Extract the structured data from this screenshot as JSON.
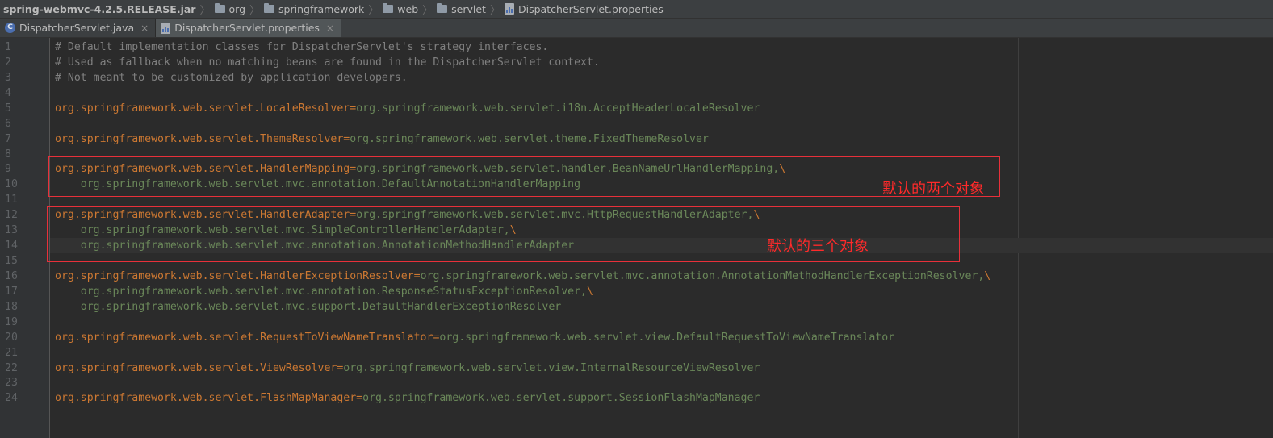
{
  "breadcrumb": {
    "items": [
      {
        "label": "spring-webmvc-4.2.5.RELEASE.jar",
        "icon": "jar"
      },
      {
        "label": "org",
        "icon": "folder-icon"
      },
      {
        "label": "springframework",
        "icon": "folder-icon"
      },
      {
        "label": "web",
        "icon": "folder-icon"
      },
      {
        "label": "servlet",
        "icon": "folder-icon"
      },
      {
        "label": "DispatcherServlet.properties",
        "icon": "properties-file-icon"
      }
    ]
  },
  "tabs": [
    {
      "label": "DispatcherServlet.java",
      "icon": "class-icon",
      "close": "×",
      "active": false
    },
    {
      "label": "DispatcherServlet.properties",
      "icon": "properties-file-icon",
      "close": "×",
      "active": true
    }
  ],
  "editor": {
    "lines": [
      {
        "num": "1",
        "comment": "# Default implementation classes for DispatcherServlet's strategy interfaces."
      },
      {
        "num": "2",
        "comment": "# Used as fallback when no matching beans are found in the DispatcherServlet context."
      },
      {
        "num": "3",
        "comment": "# Not meant to be customized by application developers."
      },
      {
        "num": "4"
      },
      {
        "num": "5",
        "key": "org.springframework.web.servlet.LocaleResolver",
        "eq": "=",
        "value": "org.springframework.web.servlet.i18n.AcceptHeaderLocaleResolver"
      },
      {
        "num": "6"
      },
      {
        "num": "7",
        "key": "org.springframework.web.servlet.ThemeResolver",
        "eq": "=",
        "value": "org.springframework.web.servlet.theme.FixedThemeResolver"
      },
      {
        "num": "8"
      },
      {
        "num": "9",
        "key": "org.springframework.web.servlet.HandlerMapping",
        "eq": "=",
        "value": "org.springframework.web.servlet.handler.BeanNameUrlHandlerMapping,",
        "cont": "\\"
      },
      {
        "num": "10",
        "value": "    org.springframework.web.servlet.mvc.annotation.DefaultAnnotationHandlerMapping"
      },
      {
        "num": "11"
      },
      {
        "num": "12",
        "key": "org.springframework.web.servlet.HandlerAdapter",
        "eq": "=",
        "value": "org.springframework.web.servlet.mvc.HttpRequestHandlerAdapter,",
        "cont": "\\"
      },
      {
        "num": "13",
        "value": "    org.springframework.web.servlet.mvc.SimpleControllerHandlerAdapter,",
        "cont": "\\"
      },
      {
        "num": "14",
        "value": "    org.springframework.web.servlet.mvc.annotation.AnnotationMethodHandlerAdapter",
        "current": true
      },
      {
        "num": "15"
      },
      {
        "num": "16",
        "key": "org.springframework.web.servlet.HandlerExceptionResolver",
        "eq": "=",
        "value": "org.springframework.web.servlet.mvc.annotation.AnnotationMethodHandlerExceptionResolver,",
        "cont": "\\"
      },
      {
        "num": "17",
        "value": "    org.springframework.web.servlet.mvc.annotation.ResponseStatusExceptionResolver,",
        "cont": "\\"
      },
      {
        "num": "18",
        "value": "    org.springframework.web.servlet.mvc.support.DefaultHandlerExceptionResolver"
      },
      {
        "num": "19"
      },
      {
        "num": "20",
        "key": "org.springframework.web.servlet.RequestToViewNameTranslator",
        "eq": "=",
        "value": "org.springframework.web.servlet.view.DefaultRequestToViewNameTranslator"
      },
      {
        "num": "21"
      },
      {
        "num": "22",
        "key": "org.springframework.web.servlet.ViewResolver",
        "eq": "=",
        "value": "org.springframework.web.servlet.view.InternalResourceViewResolver"
      },
      {
        "num": "23"
      },
      {
        "num": "24",
        "key": "org.springframework.web.servlet.FlashMapManager",
        "eq": "=",
        "value": "org.springframework.web.servlet.support.SessionFlashMapManager"
      }
    ]
  },
  "annotations": {
    "handler_mapping_note": "默认的两个对象",
    "handler_adapter_note": "默认的三个对象",
    "box_color": "#e8303a",
    "text_color": "#ff2a2a"
  },
  "colors": {
    "background": "#2b2b2b",
    "gutter": "#313335",
    "comment": "#808080",
    "key": "#cc7832",
    "value": "#6a8759",
    "line_number": "#606366"
  }
}
